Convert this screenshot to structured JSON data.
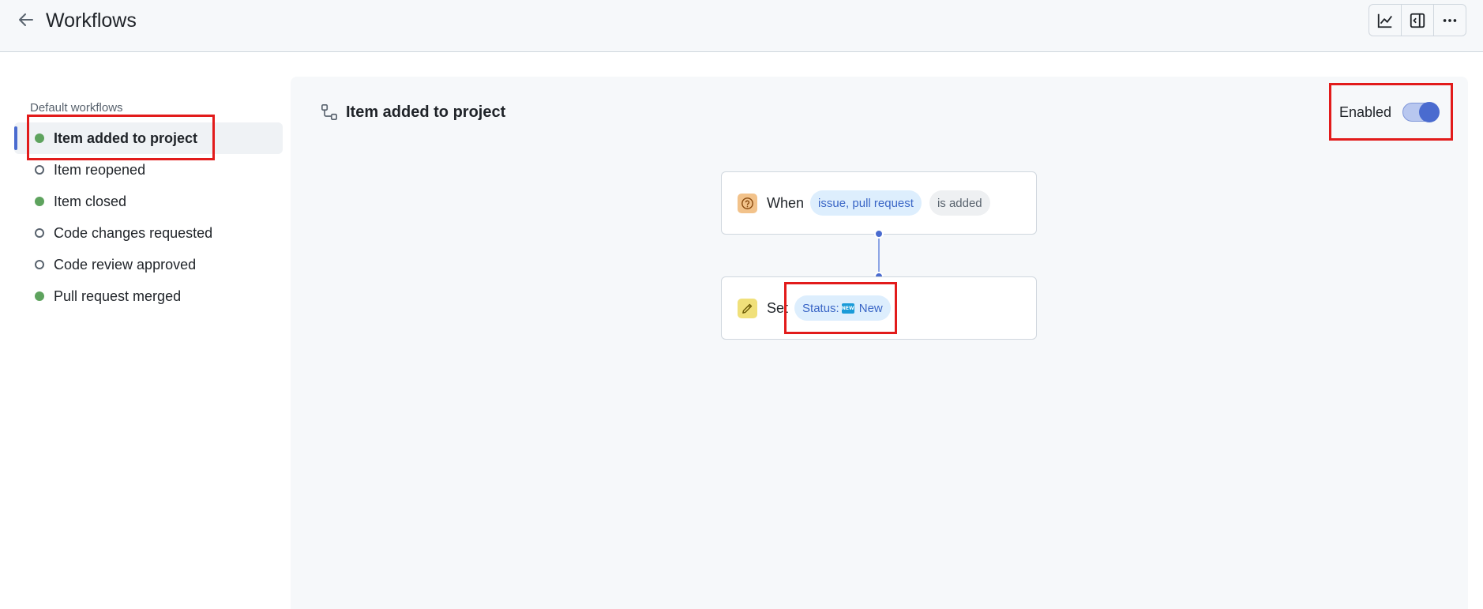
{
  "header": {
    "title": "Workflows",
    "back_icon": "arrow-left-icon",
    "toolbar": [
      {
        "icon": "graph-icon"
      },
      {
        "icon": "sidebar-expand-icon"
      },
      {
        "icon": "kebab-horizontal-icon"
      }
    ]
  },
  "sidebar": {
    "heading": "Default workflows",
    "items": [
      {
        "label": "Item added to project",
        "enabled": true,
        "active": true
      },
      {
        "label": "Item reopened",
        "enabled": false,
        "active": false
      },
      {
        "label": "Item closed",
        "enabled": true,
        "active": false
      },
      {
        "label": "Code changes requested",
        "enabled": false,
        "active": false
      },
      {
        "label": "Code review approved",
        "enabled": false,
        "active": false
      },
      {
        "label": "Pull request merged",
        "enabled": true,
        "active": false
      }
    ]
  },
  "workflow": {
    "title": "Item added to project",
    "enabled_label": "Enabled",
    "enabled": true,
    "trigger": {
      "word": "When",
      "type_pill": "issue, pull request",
      "event_pill": "is added"
    },
    "action": {
      "word": "Set",
      "field_label": "Status:",
      "value_icon_text": "NEW",
      "value": "New"
    }
  },
  "colors": {
    "accent": "#4a6bcf",
    "enabled_dot": "#5ea35e",
    "highlight": "#e21b1b"
  }
}
